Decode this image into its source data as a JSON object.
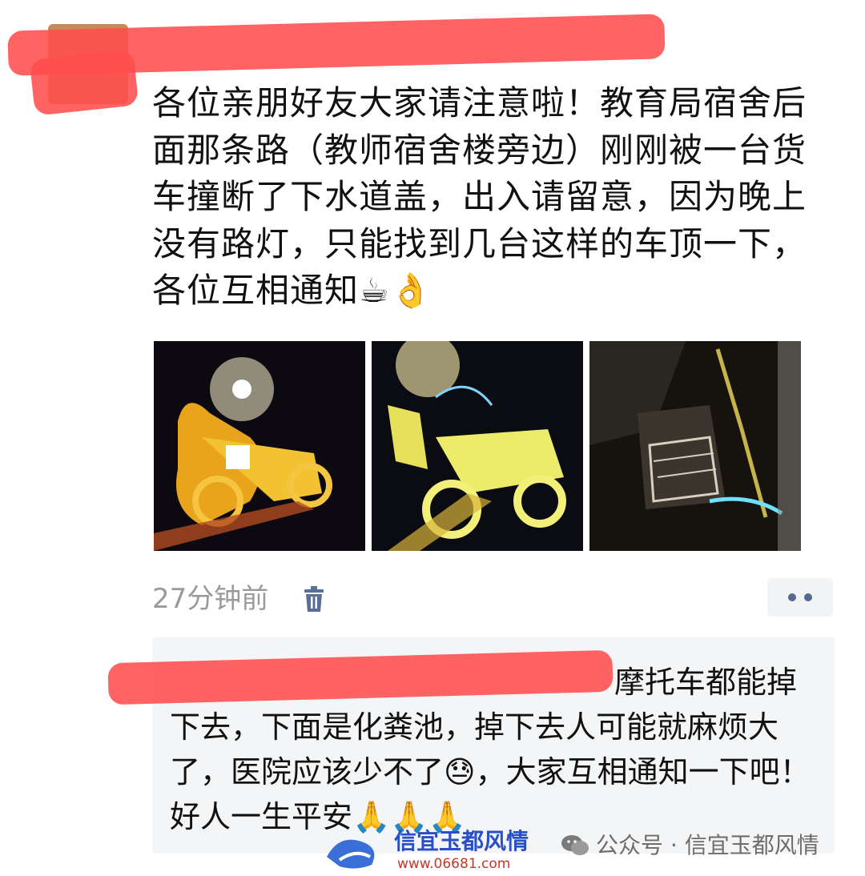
{
  "post": {
    "text": "各位亲朋好友大家请注意啦！教育局宿舍后面那条路（教师宿舍楼旁边）刚刚被一台货车撞断了下水道盖，出入请留意，因为晚上没有路灯，只能找到几台这样的车顶一下，各位互相通知☕👌",
    "time": "27分钟前"
  },
  "comment": {
    "line1": "摩托车都能掉",
    "rest": "下去，下面是化粪池，掉下去人可能就麻烦大了，医院应该少不了😓，大家互相通知一下吧！好人一生平安🙏🙏🙏"
  },
  "watermark": {
    "logo_text": "信宜玉都风情",
    "logo_url": "www.06681.com",
    "account": "公众号 · 信宜玉都风情"
  },
  "colors": {
    "redaction": "#ff4d4d",
    "meta_gray": "#9a9a9a",
    "more_dots": "#556a92",
    "comment_bg": "#f4f5f6"
  }
}
